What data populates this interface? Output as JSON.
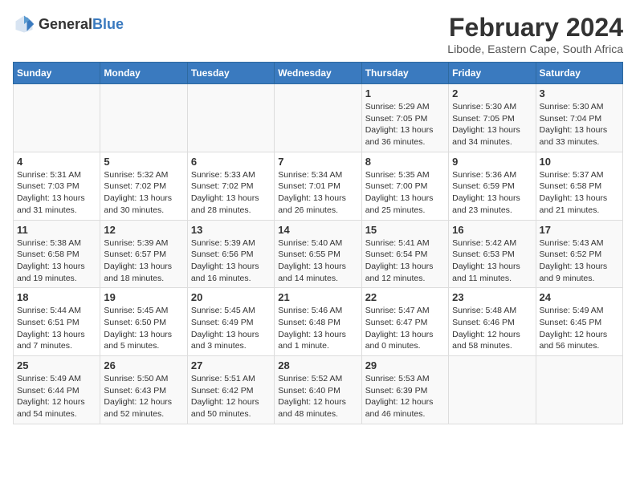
{
  "header": {
    "logo_general": "General",
    "logo_blue": "Blue",
    "title": "February 2024",
    "subtitle": "Libode, Eastern Cape, South Africa"
  },
  "weekdays": [
    "Sunday",
    "Monday",
    "Tuesday",
    "Wednesday",
    "Thursday",
    "Friday",
    "Saturday"
  ],
  "weeks": [
    [
      {
        "day": "",
        "info": ""
      },
      {
        "day": "",
        "info": ""
      },
      {
        "day": "",
        "info": ""
      },
      {
        "day": "",
        "info": ""
      },
      {
        "day": "1",
        "info": "Sunrise: 5:29 AM\nSunset: 7:05 PM\nDaylight: 13 hours and 36 minutes."
      },
      {
        "day": "2",
        "info": "Sunrise: 5:30 AM\nSunset: 7:05 PM\nDaylight: 13 hours and 34 minutes."
      },
      {
        "day": "3",
        "info": "Sunrise: 5:30 AM\nSunset: 7:04 PM\nDaylight: 13 hours and 33 minutes."
      }
    ],
    [
      {
        "day": "4",
        "info": "Sunrise: 5:31 AM\nSunset: 7:03 PM\nDaylight: 13 hours and 31 minutes."
      },
      {
        "day": "5",
        "info": "Sunrise: 5:32 AM\nSunset: 7:02 PM\nDaylight: 13 hours and 30 minutes."
      },
      {
        "day": "6",
        "info": "Sunrise: 5:33 AM\nSunset: 7:02 PM\nDaylight: 13 hours and 28 minutes."
      },
      {
        "day": "7",
        "info": "Sunrise: 5:34 AM\nSunset: 7:01 PM\nDaylight: 13 hours and 26 minutes."
      },
      {
        "day": "8",
        "info": "Sunrise: 5:35 AM\nSunset: 7:00 PM\nDaylight: 13 hours and 25 minutes."
      },
      {
        "day": "9",
        "info": "Sunrise: 5:36 AM\nSunset: 6:59 PM\nDaylight: 13 hours and 23 minutes."
      },
      {
        "day": "10",
        "info": "Sunrise: 5:37 AM\nSunset: 6:58 PM\nDaylight: 13 hours and 21 minutes."
      }
    ],
    [
      {
        "day": "11",
        "info": "Sunrise: 5:38 AM\nSunset: 6:58 PM\nDaylight: 13 hours and 19 minutes."
      },
      {
        "day": "12",
        "info": "Sunrise: 5:39 AM\nSunset: 6:57 PM\nDaylight: 13 hours and 18 minutes."
      },
      {
        "day": "13",
        "info": "Sunrise: 5:39 AM\nSunset: 6:56 PM\nDaylight: 13 hours and 16 minutes."
      },
      {
        "day": "14",
        "info": "Sunrise: 5:40 AM\nSunset: 6:55 PM\nDaylight: 13 hours and 14 minutes."
      },
      {
        "day": "15",
        "info": "Sunrise: 5:41 AM\nSunset: 6:54 PM\nDaylight: 13 hours and 12 minutes."
      },
      {
        "day": "16",
        "info": "Sunrise: 5:42 AM\nSunset: 6:53 PM\nDaylight: 13 hours and 11 minutes."
      },
      {
        "day": "17",
        "info": "Sunrise: 5:43 AM\nSunset: 6:52 PM\nDaylight: 13 hours and 9 minutes."
      }
    ],
    [
      {
        "day": "18",
        "info": "Sunrise: 5:44 AM\nSunset: 6:51 PM\nDaylight: 13 hours and 7 minutes."
      },
      {
        "day": "19",
        "info": "Sunrise: 5:45 AM\nSunset: 6:50 PM\nDaylight: 13 hours and 5 minutes."
      },
      {
        "day": "20",
        "info": "Sunrise: 5:45 AM\nSunset: 6:49 PM\nDaylight: 13 hours and 3 minutes."
      },
      {
        "day": "21",
        "info": "Sunrise: 5:46 AM\nSunset: 6:48 PM\nDaylight: 13 hours and 1 minute."
      },
      {
        "day": "22",
        "info": "Sunrise: 5:47 AM\nSunset: 6:47 PM\nDaylight: 13 hours and 0 minutes."
      },
      {
        "day": "23",
        "info": "Sunrise: 5:48 AM\nSunset: 6:46 PM\nDaylight: 12 hours and 58 minutes."
      },
      {
        "day": "24",
        "info": "Sunrise: 5:49 AM\nSunset: 6:45 PM\nDaylight: 12 hours and 56 minutes."
      }
    ],
    [
      {
        "day": "25",
        "info": "Sunrise: 5:49 AM\nSunset: 6:44 PM\nDaylight: 12 hours and 54 minutes."
      },
      {
        "day": "26",
        "info": "Sunrise: 5:50 AM\nSunset: 6:43 PM\nDaylight: 12 hours and 52 minutes."
      },
      {
        "day": "27",
        "info": "Sunrise: 5:51 AM\nSunset: 6:42 PM\nDaylight: 12 hours and 50 minutes."
      },
      {
        "day": "28",
        "info": "Sunrise: 5:52 AM\nSunset: 6:40 PM\nDaylight: 12 hours and 48 minutes."
      },
      {
        "day": "29",
        "info": "Sunrise: 5:53 AM\nSunset: 6:39 PM\nDaylight: 12 hours and 46 minutes."
      },
      {
        "day": "",
        "info": ""
      },
      {
        "day": "",
        "info": ""
      }
    ]
  ]
}
